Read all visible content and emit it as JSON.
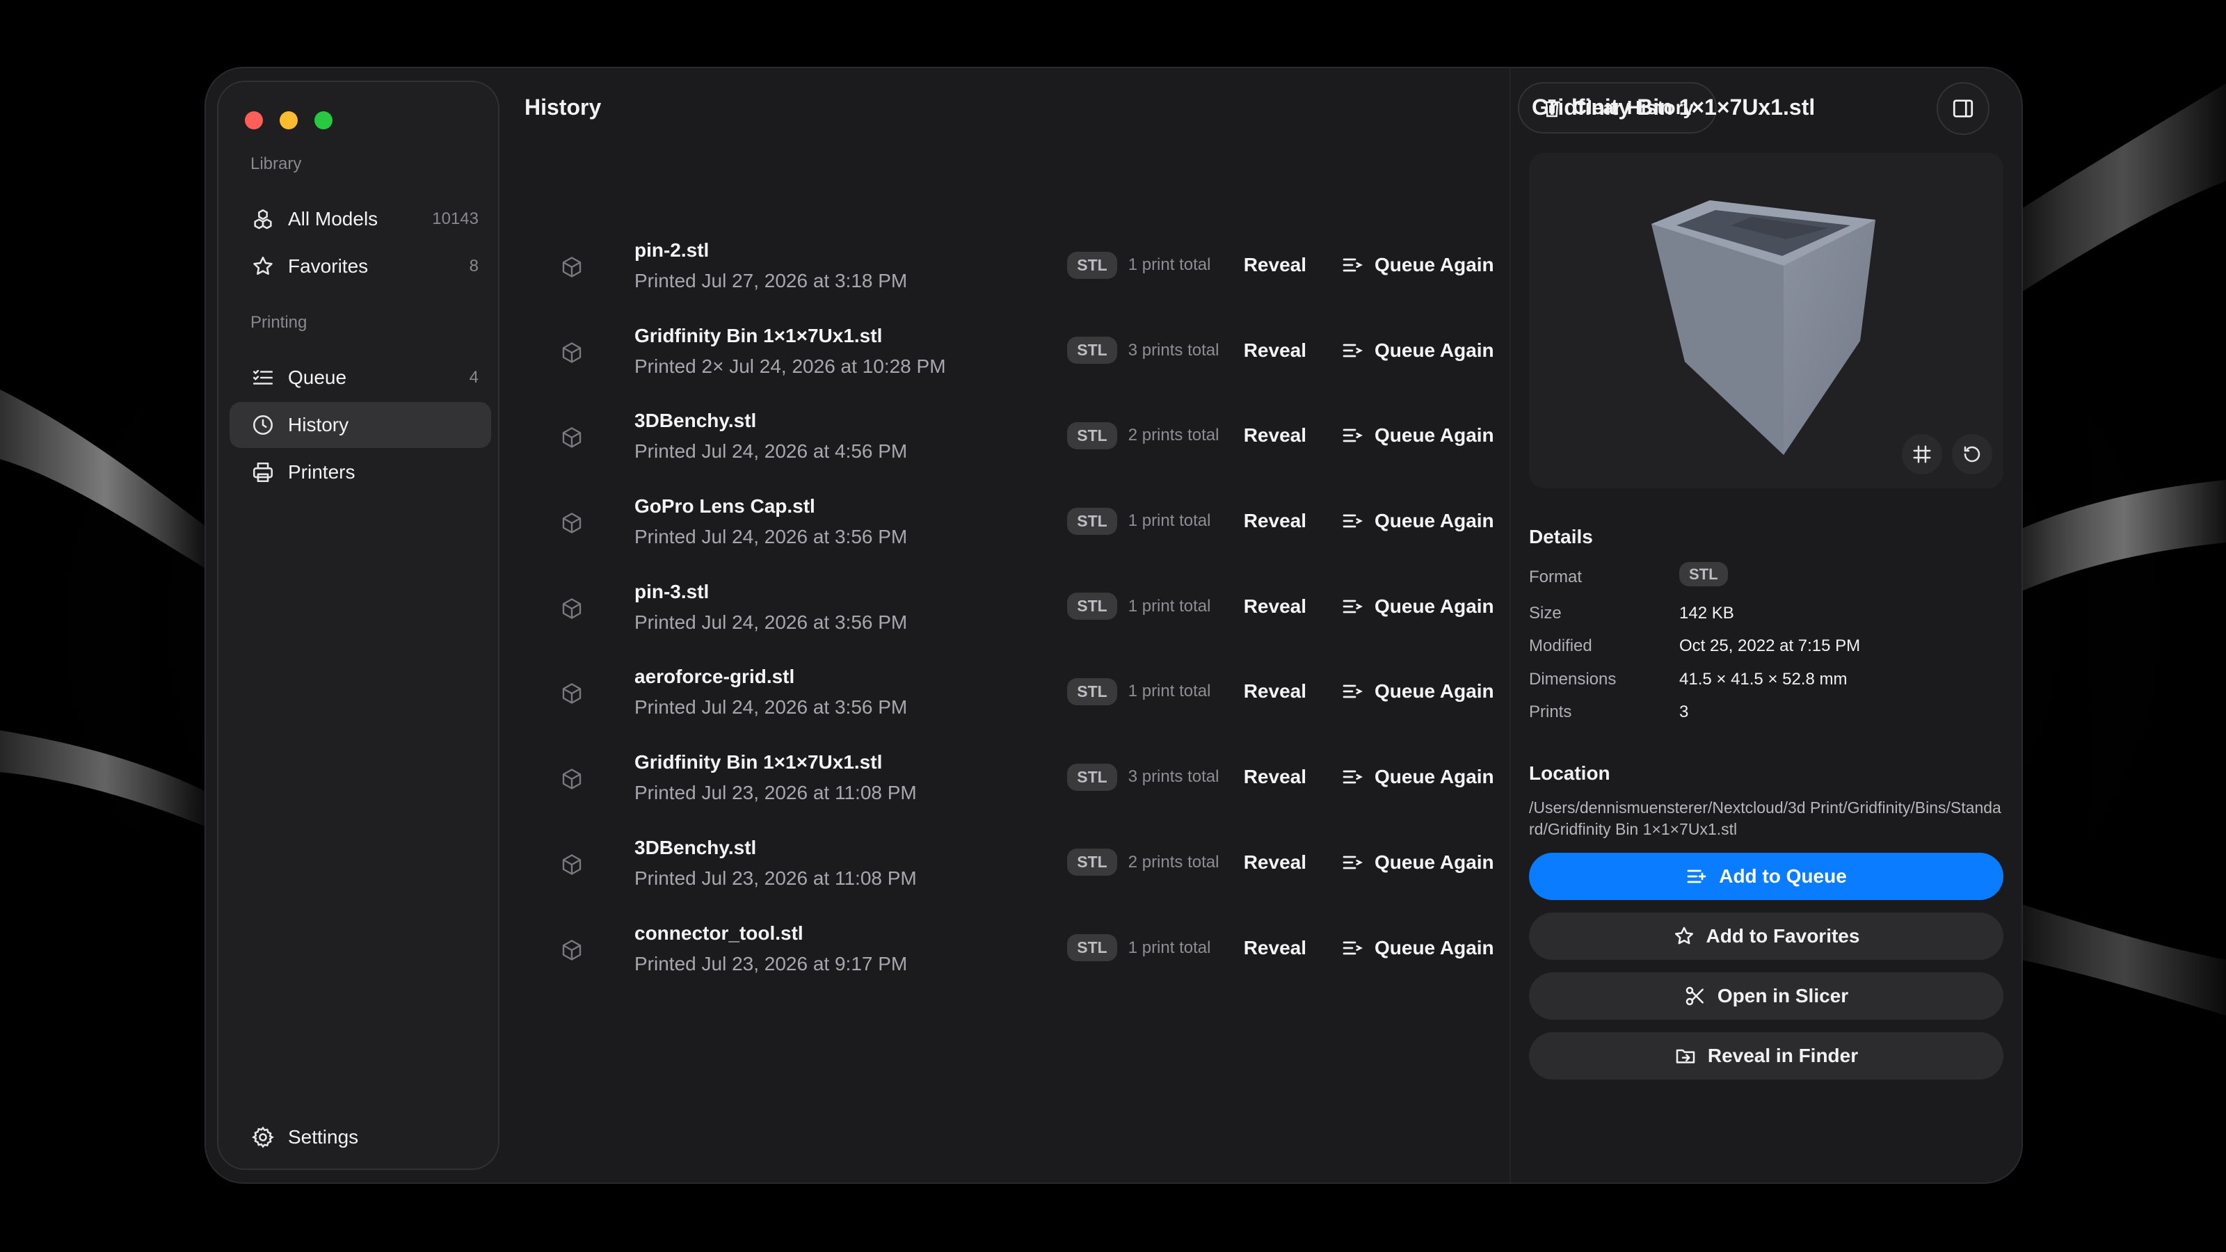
{
  "sidebar": {
    "library_label": "Library",
    "printing_label": "Printing",
    "items": [
      {
        "label": "All Models",
        "count": "10143",
        "icon": "cubes-icon"
      },
      {
        "label": "Favorites",
        "count": "8",
        "icon": "star-icon"
      },
      {
        "label": "Queue",
        "count": "4",
        "icon": "checklist-icon"
      },
      {
        "label": "History",
        "count": "",
        "icon": "clock-icon"
      },
      {
        "label": "Printers",
        "count": "",
        "icon": "printer-icon"
      }
    ],
    "settings_label": "Settings"
  },
  "main": {
    "title": "History",
    "clear_button": "Clear History",
    "rows": [
      {
        "name": "pin-2.stl",
        "sub": "Printed Jul 27, 2026 at 3:18 PM",
        "format": "STL",
        "prints": "1 print total",
        "reveal": "Reveal",
        "queue": "Queue Again"
      },
      {
        "name": "Gridfinity Bin 1×1×7Ux1.stl",
        "sub": "Printed 2× Jul 24, 2026 at 10:28 PM",
        "format": "STL",
        "prints": "3 prints total",
        "reveal": "Reveal",
        "queue": "Queue Again"
      },
      {
        "name": "3DBenchy.stl",
        "sub": "Printed Jul 24, 2026 at 4:56 PM",
        "format": "STL",
        "prints": "2 prints total",
        "reveal": "Reveal",
        "queue": "Queue Again"
      },
      {
        "name": "GoPro Lens Cap.stl",
        "sub": "Printed Jul 24, 2026 at 3:56 PM",
        "format": "STL",
        "prints": "1 print total",
        "reveal": "Reveal",
        "queue": "Queue Again"
      },
      {
        "name": "pin-3.stl",
        "sub": "Printed Jul 24, 2026 at 3:56 PM",
        "format": "STL",
        "prints": "1 print total",
        "reveal": "Reveal",
        "queue": "Queue Again"
      },
      {
        "name": "aeroforce-grid.stl",
        "sub": "Printed Jul 24, 2026 at 3:56 PM",
        "format": "STL",
        "prints": "1 print total",
        "reveal": "Reveal",
        "queue": "Queue Again"
      },
      {
        "name": "Gridfinity Bin 1×1×7Ux1.stl",
        "sub": "Printed Jul 23, 2026 at 11:08 PM",
        "format": "STL",
        "prints": "3 prints total",
        "reveal": "Reveal",
        "queue": "Queue Again"
      },
      {
        "name": "3DBenchy.stl",
        "sub": "Printed Jul 23, 2026 at 11:08 PM",
        "format": "STL",
        "prints": "2 prints total",
        "reveal": "Reveal",
        "queue": "Queue Again"
      },
      {
        "name": "connector_tool.stl",
        "sub": "Printed Jul 23, 2026 at 9:17 PM",
        "format": "STL",
        "prints": "1 print total",
        "reveal": "Reveal",
        "queue": "Queue Again"
      }
    ]
  },
  "detail": {
    "title": "Gridfinity Bin 1×1×7Ux1.stl",
    "details_heading": "Details",
    "fields": {
      "format_label": "Format",
      "format": "STL",
      "size_label": "Size",
      "size": "142 KB",
      "modified_label": "Modified",
      "modified": "Oct 25, 2022 at 7:15 PM",
      "dimensions_label": "Dimensions",
      "dimensions": "41.5 × 41.5 × 52.8 mm",
      "prints_label": "Prints",
      "prints": "3"
    },
    "location_heading": "Location",
    "location": "/Users/dennismuensterer/Nextcloud/3d Print/Gridfinity/Bins/Standard/Gridfinity Bin 1×1×7Ux1.stl",
    "actions": {
      "add_to_queue": "Add to Queue",
      "add_to_favorites": "Add to Favorites",
      "open_in_slicer": "Open in Slicer",
      "reveal_in_finder": "Reveal in Finder"
    }
  },
  "colors": {
    "accent": "#0a7cff",
    "window_bg": "#1b1b1d",
    "sidebar_active": "#333336"
  }
}
